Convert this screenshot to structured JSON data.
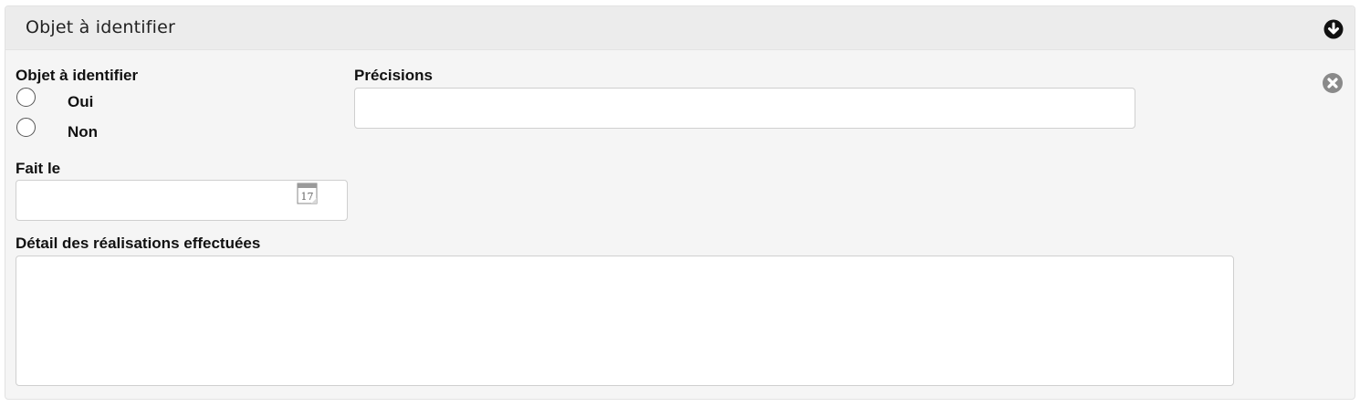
{
  "panel": {
    "title": "Objet à identifier",
    "icons": {
      "collapse": "arrow-down-circle-icon",
      "remove": "close-circle-icon"
    }
  },
  "form": {
    "objet_label": "Objet à identifier",
    "options": [
      "Oui",
      "Non"
    ],
    "precisions_label": "Précisions",
    "precisions_value": "",
    "fait_le_label": "Fait le",
    "fait_le_value": "",
    "calendar_day": "17",
    "detail_label": "Détail des réalisations effectuées",
    "detail_value": ""
  },
  "colors": {
    "panel_bg": "#f5f5f5",
    "header_bg": "#ececec",
    "icon_dark": "#111111",
    "icon_grey": "#8a8a8a"
  }
}
